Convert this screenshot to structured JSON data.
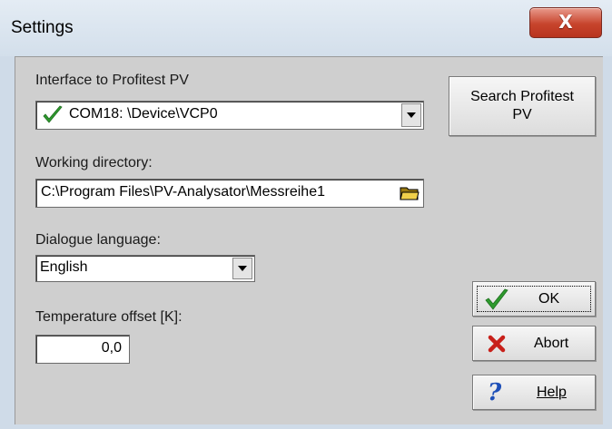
{
  "window": {
    "title": "Settings",
    "close_glyph": "X"
  },
  "interface": {
    "label": "Interface to Profitest PV",
    "selected": "COM18: \\Device\\VCP0",
    "status_icon": "green-checkmark-icon"
  },
  "search_button": {
    "line1": "Search Profitest",
    "line2": "PV"
  },
  "working_dir": {
    "label": "Working directory:",
    "value": "C:\\Program Files\\PV-Analysator\\Messreihe1",
    "browse_icon": "folder-icon"
  },
  "language": {
    "label": "Dialogue language:",
    "selected": "English"
  },
  "temperature": {
    "label": "Temperature offset [K]:",
    "value": "0,0"
  },
  "buttons": {
    "ok": {
      "label": "OK",
      "icon": "green-checkmark-icon"
    },
    "abort": {
      "label": "Abort",
      "icon": "red-cross-icon"
    },
    "help": {
      "label": "Help",
      "icon": "question-mark-icon"
    }
  },
  "colors": {
    "title_bar": "#d3dfeb",
    "client": "#cfcfcf",
    "close_button": "#c7442c",
    "check_green": "#2e9a2e",
    "abort_red": "#c8201a",
    "help_blue": "#1d4fb8"
  }
}
